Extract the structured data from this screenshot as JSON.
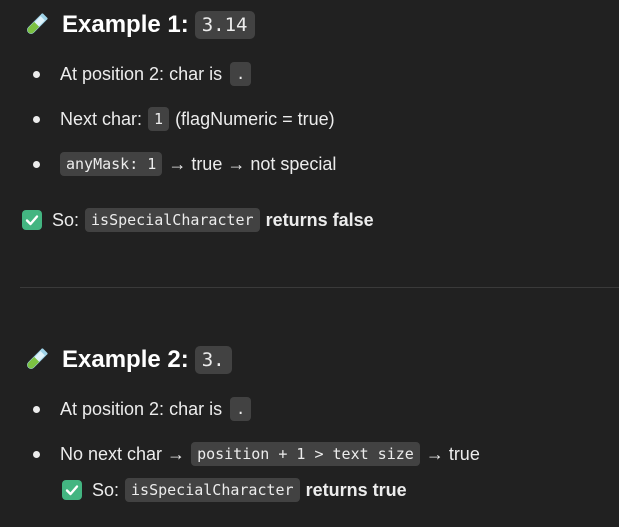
{
  "example1": {
    "title": "Example 1:",
    "code": "3.14",
    "bullet1": {
      "text": "At position 2: char is",
      "code": "."
    },
    "bullet2": {
      "text": "Next char:",
      "code": "1",
      "suffix": "(flagNumeric = true)"
    },
    "bullet3": {
      "code": "anyMask: 1",
      "suffix": "→ true → not special"
    },
    "result": {
      "prefix": "So:",
      "code": "isSpecialCharacter",
      "suffix": "returns false"
    }
  },
  "example2": {
    "title": "Example 2:",
    "code": "3.",
    "bullet1": {
      "text": "At position 2: char is",
      "code": "."
    },
    "bullet2": {
      "text": "No next char →",
      "code": "position + 1 > text size",
      "suffix": "→ true"
    },
    "result": {
      "prefix": "So:",
      "code": "isSpecialCharacter",
      "suffix": "returns true"
    }
  },
  "icons": {
    "heading_icon": "test-tube-icon",
    "result_icon": "check-mark-button-icon"
  },
  "colors": {
    "background": "#212121",
    "text": "#ececec",
    "inline_code_bg": "#424242",
    "check_green": "#43b581"
  }
}
